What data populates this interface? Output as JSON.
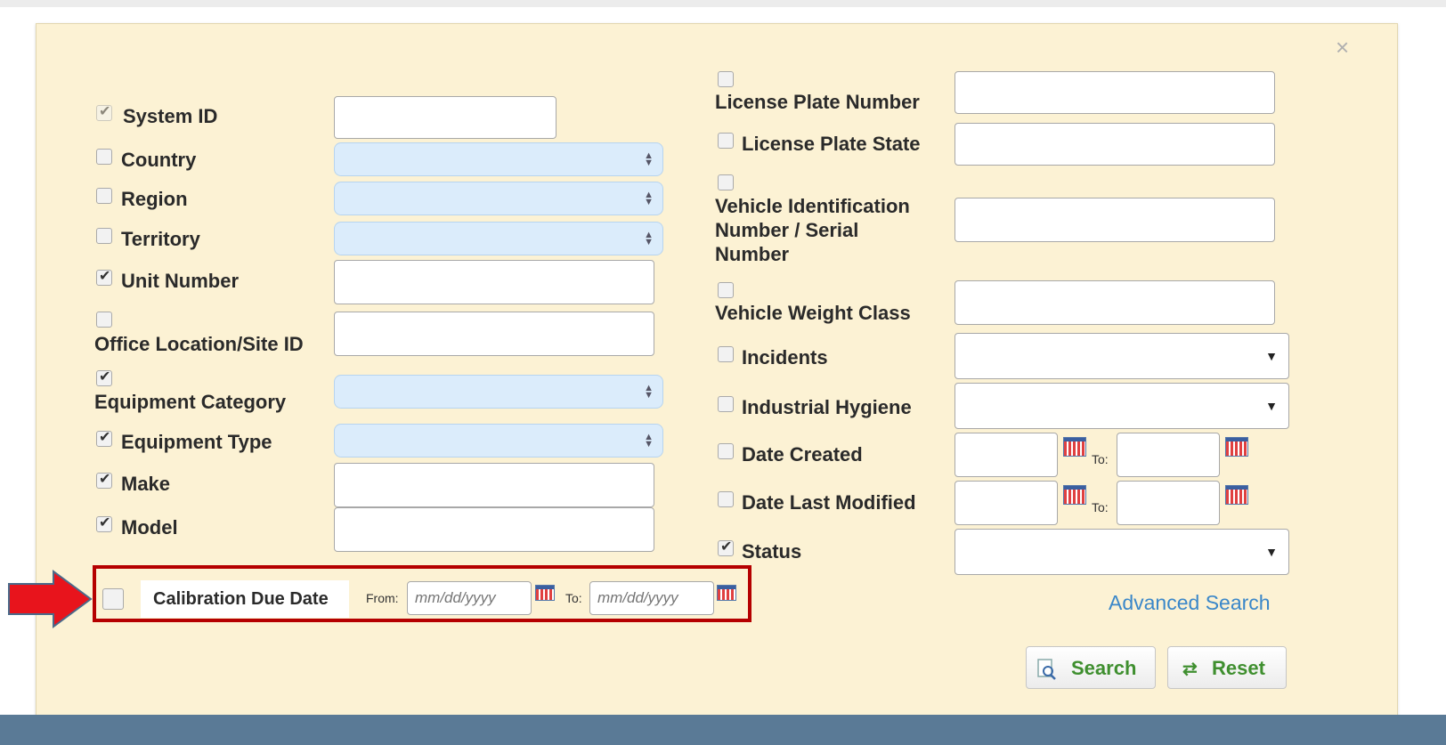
{
  "close_icon": "×",
  "left_fields": [
    {
      "label": "System ID",
      "checked": true,
      "disabled": true
    },
    {
      "label": "Country",
      "checked": false
    },
    {
      "label": "Region",
      "checked": false
    },
    {
      "label": "Territory",
      "checked": false
    },
    {
      "label": "Unit Number",
      "checked": true
    },
    {
      "label": "Office Location/Site ID",
      "checked": false
    },
    {
      "label": "Equipment Category",
      "checked": true
    },
    {
      "label": "Equipment Type",
      "checked": true
    },
    {
      "label": "Make",
      "checked": true
    },
    {
      "label": "Model",
      "checked": true
    }
  ],
  "right_fields": [
    {
      "label": "License Plate Number",
      "checked": false
    },
    {
      "label": "License Plate State",
      "checked": false
    },
    {
      "label_lines": [
        "Vehicle Identification",
        "Number / Serial",
        "Number"
      ],
      "checked": false
    },
    {
      "label": "Vehicle Weight Class",
      "checked": false
    },
    {
      "label": "Incidents",
      "checked": false
    },
    {
      "label": "Industrial Hygiene",
      "checked": false
    },
    {
      "label": "Date Created",
      "checked": false,
      "to_label": "To:"
    },
    {
      "label": "Date Last Modified",
      "checked": false,
      "to_label": "To:"
    },
    {
      "label": "Status",
      "checked": true
    }
  ],
  "calibration": {
    "label": "Calibration Due Date",
    "from_label": "From:",
    "from_placeholder": "mm/dd/yyyy",
    "to_label": "To:",
    "to_placeholder": "mm/dd/yyyy",
    "checked": false
  },
  "advanced_search_label": "Advanced Search",
  "search_button": "Search",
  "reset_button": "Reset",
  "colors": {
    "panel_bg": "#fcf2d4",
    "highlight_border": "#b50000",
    "arrow": "#e8141c",
    "link": "#3a87c9",
    "button_text": "#3f8f2f",
    "bottom_bar": "#5a7a96"
  },
  "icons": {
    "close": "close-icon",
    "calendar": "calendar-icon",
    "search": "search-icon",
    "reset": "refresh-icon",
    "annotation": "red-arrow-icon"
  }
}
